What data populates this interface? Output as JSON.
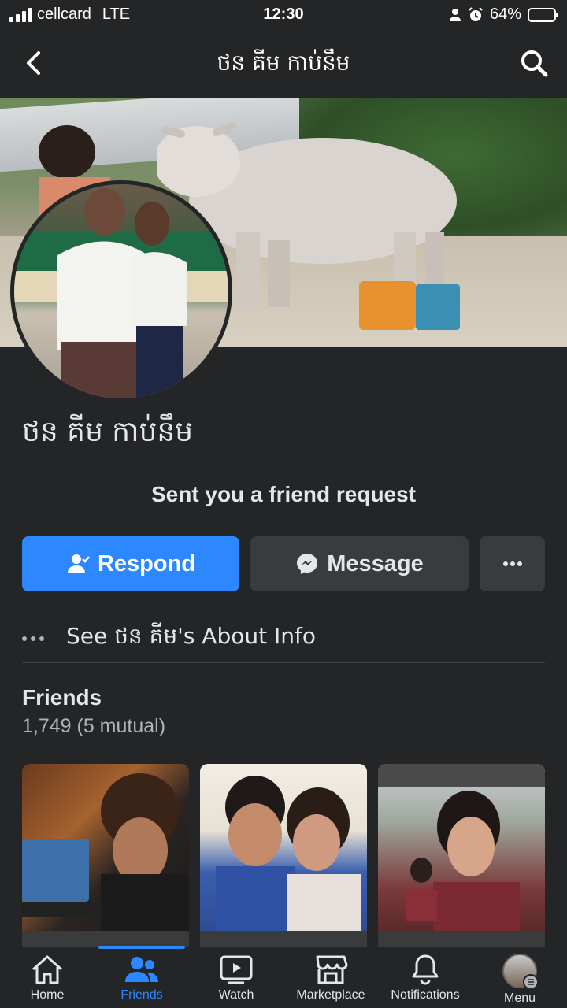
{
  "status_bar": {
    "carrier": "cellcard",
    "network": "LTE",
    "time": "12:30",
    "battery_percent": "64%",
    "battery_level": 0.64
  },
  "nav": {
    "title": "ថន គីម កាប់នឹម",
    "back_icon": "chevron-left-icon",
    "search_icon": "search-icon"
  },
  "profile": {
    "name": "ថន គីម កាប់នឹម",
    "request_text": "Sent you a friend request"
  },
  "actions": {
    "respond_label": "Respond",
    "message_label": "Message"
  },
  "about": {
    "label": "See ថន គីម's About Info"
  },
  "friends": {
    "title": "Friends",
    "count_text": "1,749 (5 mutual)"
  },
  "tabs": [
    {
      "label": "Home",
      "icon": "home-icon"
    },
    {
      "label": "Friends",
      "icon": "friends-icon",
      "active": true
    },
    {
      "label": "Watch",
      "icon": "watch-icon"
    },
    {
      "label": "Marketplace",
      "icon": "marketplace-icon"
    },
    {
      "label": "Notifications",
      "icon": "bell-icon"
    },
    {
      "label": "Menu",
      "icon": "menu-avatar"
    }
  ],
  "colors": {
    "background": "#242526",
    "accent": "#2d88ff",
    "button_secondary": "#3a3b3c",
    "text_primary": "#e4e6eb",
    "text_secondary": "#b0b3b8"
  }
}
